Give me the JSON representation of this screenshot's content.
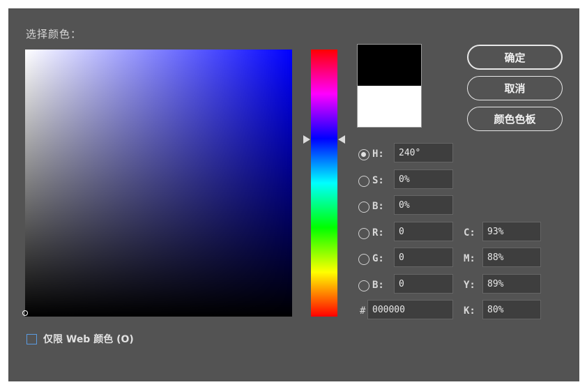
{
  "dialog": {
    "title": "选择颜色："
  },
  "preview": {
    "new_color": "#000000",
    "old_color": "#ffffff"
  },
  "buttons": {
    "ok": "确定",
    "cancel": "取消",
    "swatches": "颜色色板"
  },
  "hsb": {
    "h_label": "H:",
    "h_value": "240°",
    "s_label": "S:",
    "s_value": "0%",
    "b_label": "B:",
    "b_value": "0%"
  },
  "rgb": {
    "r_label": "R:",
    "r_value": "0",
    "g_label": "G:",
    "g_value": "0",
    "b_label": "B:",
    "b_value": "0"
  },
  "hex": {
    "label": "#",
    "value": "000000"
  },
  "cmyk": {
    "c_label": "C:",
    "c_value": "93%",
    "m_label": "M:",
    "m_value": "88%",
    "y_label": "Y:",
    "y_value": "89%",
    "k_label": "K:",
    "k_value": "80%"
  },
  "web_only": {
    "label": "仅限 Web 颜色 (O)",
    "checked": false
  },
  "colors": {
    "dialog_bg": "#535353",
    "hue": "#0000ff",
    "accent_checkbox": "#5b9be0"
  },
  "selected_mode": "H"
}
